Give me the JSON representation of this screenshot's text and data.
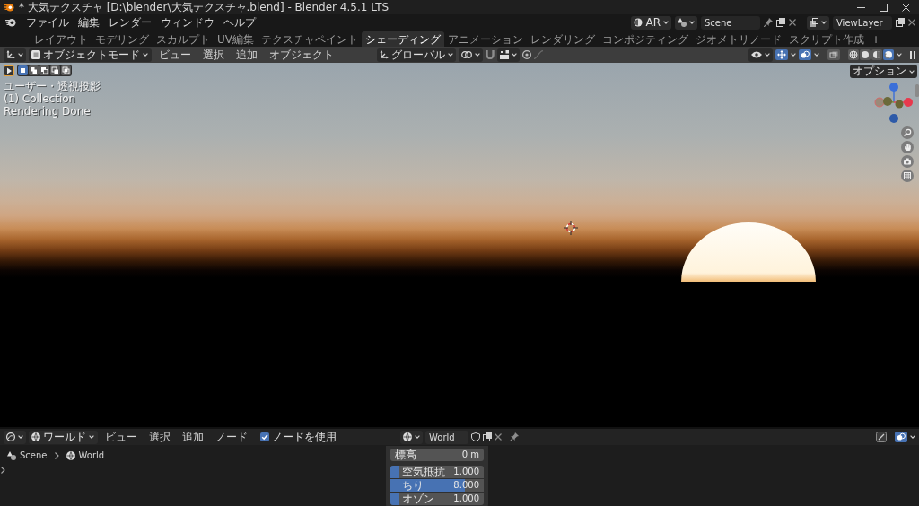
{
  "window": {
    "title": "* 大気テクスチャ [D:\\blender\\大気テクスチャ.blend] - Blender 4.5.1 LTS"
  },
  "menu_bar": {
    "menus": [
      "ファイル",
      "編集",
      "レンダー",
      "ウィンドウ",
      "ヘルプ"
    ],
    "xr": "AR",
    "scene": "Scene",
    "view_layer": "ViewLayer"
  },
  "workspace_tabs": {
    "tabs": [
      {
        "label": "レイアウト",
        "selected": false
      },
      {
        "label": "モデリング",
        "selected": false
      },
      {
        "label": "スカルプト",
        "selected": false
      },
      {
        "label": "UV編集",
        "selected": false
      },
      {
        "label": "テクスチャペイント",
        "selected": false
      },
      {
        "label": "シェーディング",
        "selected": true
      },
      {
        "label": "アニメーション",
        "selected": false
      },
      {
        "label": "レンダリング",
        "selected": false
      },
      {
        "label": "コンポジティング",
        "selected": false
      },
      {
        "label": "ジオメトリノード",
        "selected": false
      },
      {
        "label": "スクリプト作成",
        "selected": false
      }
    ],
    "add": "+"
  },
  "viewport_header": {
    "mode": "オブジェクトモード",
    "menus": [
      "ビュー",
      "選択",
      "追加",
      "オブジェクト"
    ],
    "orientation": "グローバル",
    "gizmos": {
      "on": true
    },
    "overlays": {
      "on": true
    },
    "xray": {
      "on": false
    },
    "shading_modes": [
      {
        "selected": false
      },
      {
        "selected": false
      },
      {
        "selected": false
      },
      {
        "selected": true
      }
    ]
  },
  "tool_settings": {
    "select_modes": [
      {
        "selected": true
      },
      {
        "selected": false
      },
      {
        "selected": false
      },
      {
        "selected": false
      },
      {
        "selected": false
      }
    ],
    "options": "オプション"
  },
  "viewport": {
    "overlay_text": [
      "ユーザー・透視投影",
      "(1) Collection",
      "Rendering Done"
    ]
  },
  "node_editor": {
    "editor": "ワールド",
    "menus": [
      "ビュー",
      "選択",
      "追加",
      "ノード"
    ],
    "use_nodes": {
      "label": "ノードを使用",
      "checked": true
    },
    "world": "World",
    "overlays": {
      "on": true
    },
    "breadcrumbs": [
      "Scene",
      "World"
    ],
    "node_rows": [
      {
        "kind": "field",
        "label": "標高",
        "value": "0 m"
      },
      {
        "kind": "slider",
        "label": "空気抵抗",
        "value": "1.000",
        "level": 0.1
      },
      {
        "kind": "slider",
        "label": "ちり",
        "value": "8.000",
        "level": 0.8
      },
      {
        "kind": "slider",
        "label": "オゾン",
        "value": "1.000",
        "level": 0.1
      }
    ]
  }
}
